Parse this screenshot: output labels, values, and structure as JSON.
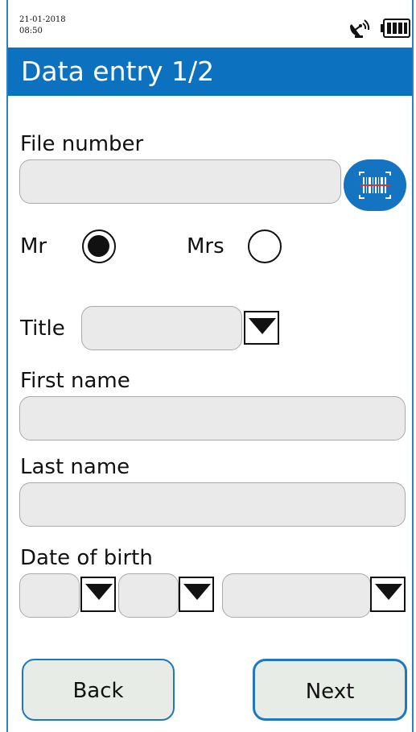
{
  "status": {
    "date": "21-01-2018",
    "time": "08:50",
    "signal_icon": "satellite-signal-icon",
    "battery_icon": "battery-full-icon"
  },
  "header": {
    "title": "Data entry 1/2",
    "color": "#0c71be"
  },
  "form": {
    "file_number_label": "File number",
    "file_number_value": "",
    "scan_icon": "barcode-scan-icon",
    "gender": {
      "mr_label": "Mr",
      "mrs_label": "Mrs",
      "selected": "Mr"
    },
    "title_label": "Title",
    "title_value": "",
    "first_name_label": "First name",
    "first_name_value": "",
    "last_name_label": "Last name",
    "last_name_value": "",
    "dob_label": "Date of birth",
    "dob_day": "",
    "dob_month": "",
    "dob_year": ""
  },
  "nav": {
    "back_label": "Back",
    "next_label": "Next",
    "border_color": "#1f77bd"
  }
}
